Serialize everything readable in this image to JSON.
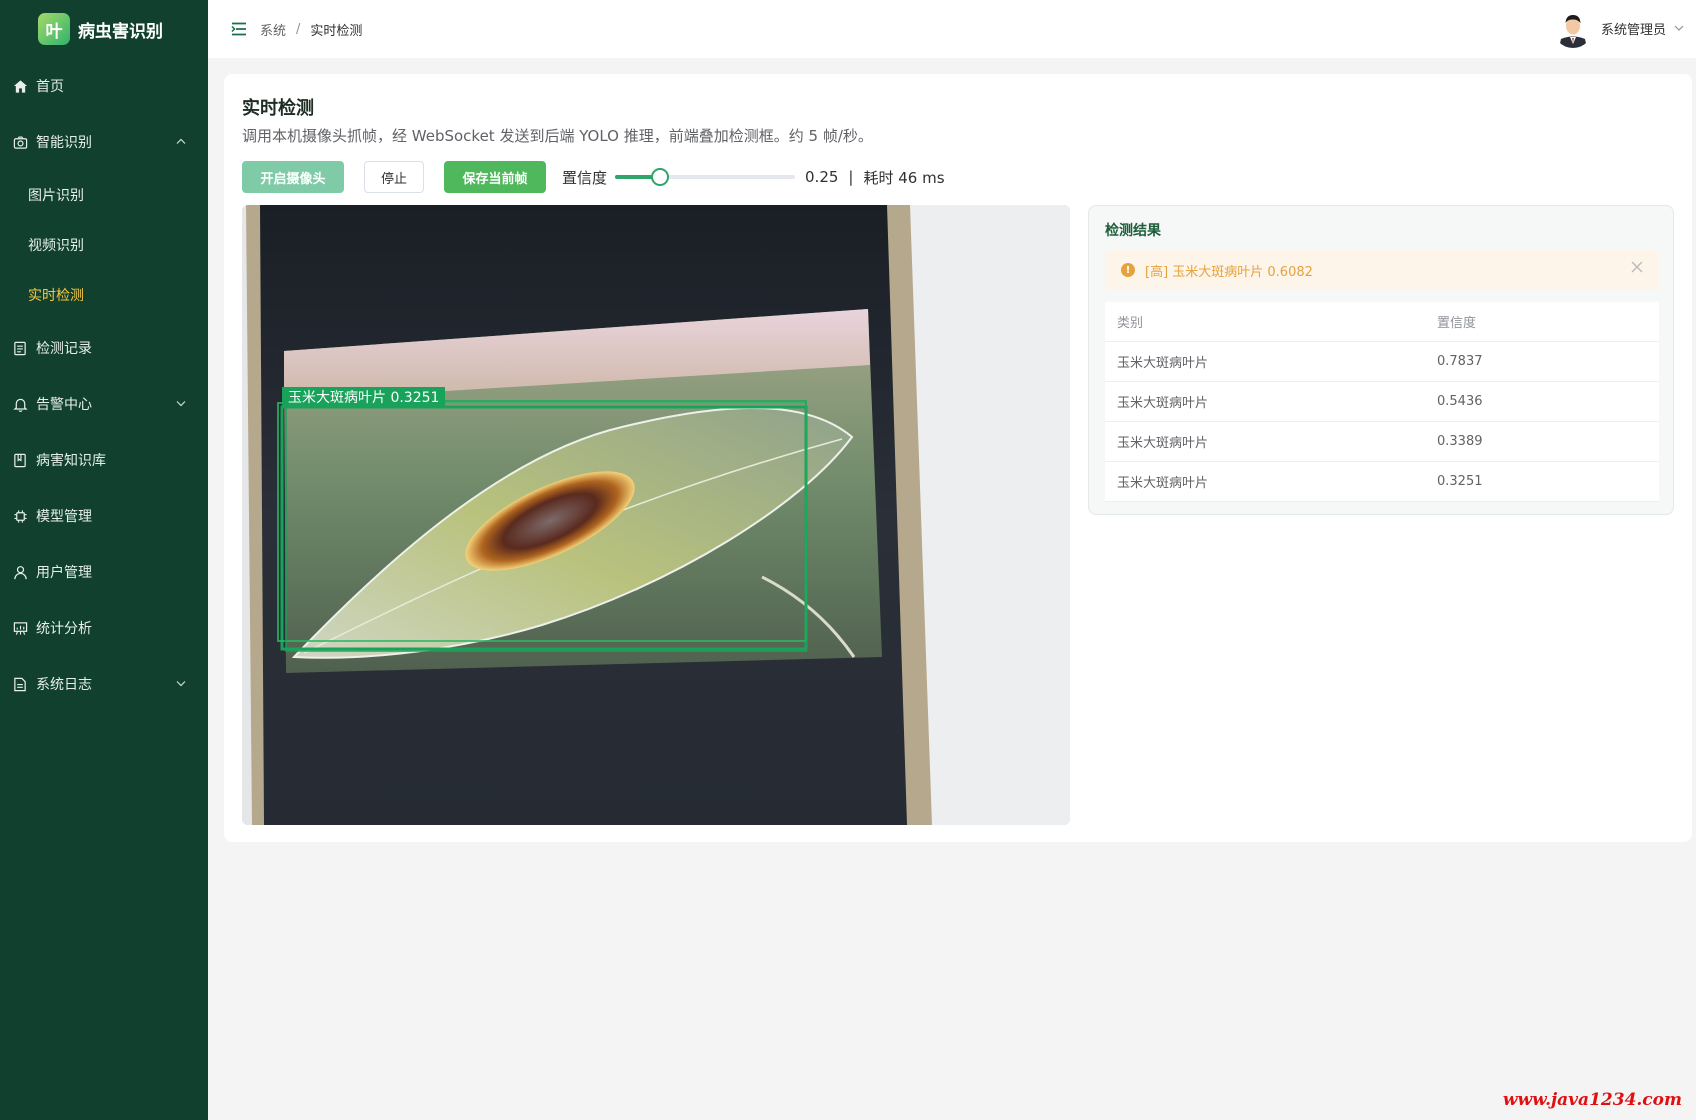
{
  "app": {
    "logo_char": "叶",
    "title": "病虫害识别"
  },
  "sidebar": {
    "home": "首页",
    "smart_recognition": "智能识别",
    "sub_items": [
      "图片识别",
      "视频识别",
      "实时检测"
    ],
    "records": "检测记录",
    "alerts": "告警中心",
    "knowledge": "病害知识库",
    "models": "模型管理",
    "users": "用户管理",
    "stats": "统计分析",
    "logs": "系统日志"
  },
  "header": {
    "breadcrumb": [
      "系统",
      "实时检测"
    ],
    "user_name": "系统管理员"
  },
  "page": {
    "title": "实时检测",
    "description": "调用本机摄像头抓帧，经 WebSocket 发送到后端 YOLO 推理，前端叠加检测框。约 5 帧/秒。"
  },
  "toolbar": {
    "start_label": "开启摄像头",
    "stop_label": "停止",
    "save_label": "保存当前帧",
    "confidence_label": "置信度",
    "confidence_value": "0.25",
    "confidence_fraction": 0.25,
    "separator": "|",
    "latency": "耗时 46 ms"
  },
  "video": {
    "detection_label": "玉米大斑病叶片 0.3251"
  },
  "results": {
    "title": "检测结果",
    "alert": "[高] 玉米大斑病叶片 0.6082",
    "columns": [
      "类别",
      "置信度"
    ],
    "rows": [
      {
        "category": "玉米大斑病叶片",
        "confidence": "0.7837"
      },
      {
        "category": "玉米大斑病叶片",
        "confidence": "0.5436"
      },
      {
        "category": "玉米大斑病叶片",
        "confidence": "0.3389"
      },
      {
        "category": "玉米大斑病叶片",
        "confidence": "0.3251"
      }
    ]
  },
  "watermark": "www.java1234.com",
  "colors": {
    "sidebar_bg": "#11402f",
    "active_menu": "#f5c842",
    "primary": "#2fa56b",
    "success_button": "#4fb75c",
    "detection_box": "#19a35a",
    "warning": "#e6a23c"
  },
  "icons": {
    "home": "home-icon",
    "camera": "camera-icon",
    "records": "document-list-icon",
    "alerts": "bell-icon",
    "knowledge": "book-icon",
    "models": "chip-icon",
    "users": "user-icon",
    "stats": "chart-board-icon",
    "logs": "file-text-icon"
  }
}
